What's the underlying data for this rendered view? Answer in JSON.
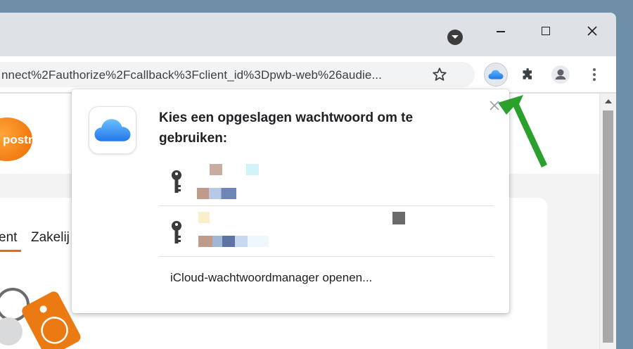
{
  "browser": {
    "url_fragment": "nnect%2Fauthorize%2Fcallback%3Fclient_id%3Dpwb-web%26audie...",
    "icons": {
      "tab_search": "chevron-down-circle-icon",
      "star": "star-outline-icon",
      "icloud_extension": "icloud-cloud-icon",
      "extensions": "puzzle-icon",
      "profile": "person-icon",
      "menu": "three-dots-vertical-icon"
    },
    "accent_color": "#2c8cf4"
  },
  "page": {
    "logo_text": "postnl",
    "tabs_partial": [
      "ent",
      "Zakelij"
    ],
    "accent_color": "#ec6a00"
  },
  "popup": {
    "title": "Kies een opgeslagen wachtwoord om te gebruiken:",
    "footer_link": "iCloud-wachtwoordmanager openen...",
    "credentials": [
      {
        "icon": "key-icon"
      },
      {
        "icon": "key-icon"
      }
    ]
  },
  "annotation": {
    "arrow_color": "#2ca02c"
  }
}
